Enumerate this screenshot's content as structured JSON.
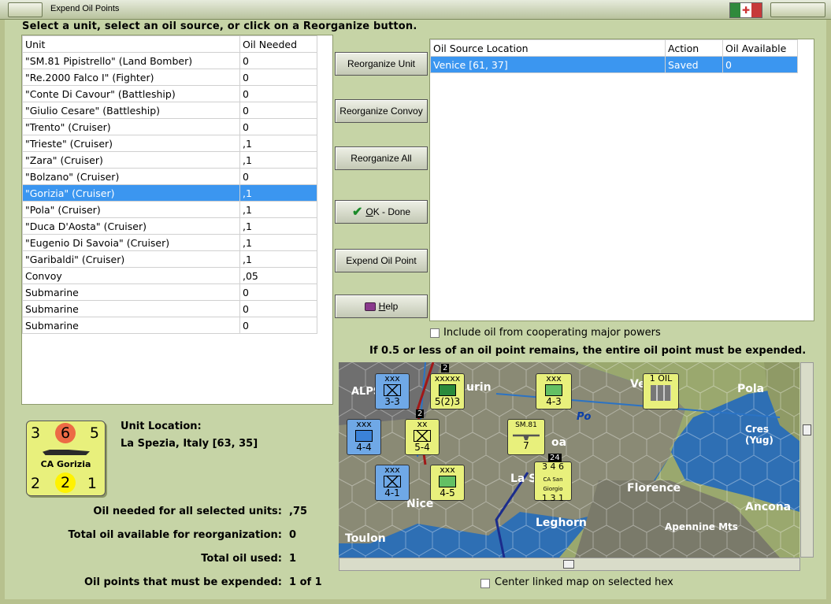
{
  "window": {
    "title": "Expend Oil Points"
  },
  "instruction": "Select a unit, select an oil source, or click on a Reorganize button.",
  "units_table": {
    "headers": [
      "Unit",
      "Oil Needed"
    ],
    "rows": [
      [
        "\"SM.81 Pipistrello\" (Land Bomber)",
        "0"
      ],
      [
        "\"Re.2000 Falco I\" (Fighter)",
        "0"
      ],
      [
        "\"Conte Di Cavour\" (Battleship)",
        "0"
      ],
      [
        "\"Giulio Cesare\" (Battleship)",
        "0"
      ],
      [
        "\"Trento\" (Cruiser)",
        "0"
      ],
      [
        "\"Trieste\" (Cruiser)",
        ",1"
      ],
      [
        "\"Zara\" (Cruiser)",
        ",1"
      ],
      [
        "\"Bolzano\" (Cruiser)",
        "0"
      ],
      [
        "\"Gorizia\" (Cruiser)",
        ",1"
      ],
      [
        "\"Pola\" (Cruiser)",
        ",1"
      ],
      [
        "\"Duca D'Aosta\" (Cruiser)",
        ",1"
      ],
      [
        "\"Eugenio Di Savoia\" (Cruiser)",
        ",1"
      ],
      [
        "\"Garibaldi\" (Cruiser)",
        ",1"
      ],
      [
        "Convoy",
        ",05"
      ],
      [
        "Submarine",
        "0"
      ],
      [
        "Submarine",
        "0"
      ],
      [
        "Submarine",
        "0"
      ]
    ],
    "selected_index": 8
  },
  "buttons": {
    "reorganize_unit": "Reorganize Unit",
    "reorganize_convoy": "Reorganize Convoy",
    "reorganize_all": "Reorganize All",
    "ok_done_first": "O",
    "ok_done_rest": "K - Done",
    "expend_oil_point": "Expend Oil Point",
    "help_first": "H",
    "help_rest": "elp"
  },
  "source_table": {
    "headers": [
      "Oil Source Location",
      "Action",
      "Oil Available"
    ],
    "rows": [
      [
        "Venice [61, 37]",
        "Saved",
        "0"
      ]
    ]
  },
  "include_oil_label": "Include oil from cooperating major powers",
  "oil_rule_note": "If 0.5 or less of an oil point remains, the entire oil point must be expended.",
  "unit_counter": {
    "top_left": "3",
    "top_mid": "6",
    "top_right": "5",
    "name": "CA Gorizia",
    "bottom_left": "2",
    "bottom_mid": "2",
    "bottom_right": "1"
  },
  "unit_location": {
    "label": "Unit Location:",
    "value": "La Spezia, Italy [63, 35]"
  },
  "summary": [
    {
      "label": "Oil needed for all selected units:",
      "value": ",75"
    },
    {
      "label": "Total oil available for reorganization:",
      "value": "0"
    },
    {
      "label": "Total oil used:",
      "value": "1"
    },
    {
      "label": "Oil points that must be expended:",
      "value": "1 of 1"
    }
  ],
  "center_map_label": "Center linked map on selected hex",
  "map": {
    "places": [
      "ALPS",
      "urin",
      "Ve",
      "Pola",
      "Po",
      "Cres (Yug)",
      "oa",
      "La S",
      "Florence",
      "Nice",
      "Leghorn",
      "Apennine Mts",
      "Ancona",
      "Toulon"
    ],
    "counters": [
      {
        "text": "3-3",
        "top": "xxx"
      },
      {
        "text": "5(2)3",
        "top": "xxxxx"
      },
      {
        "text": "4-3",
        "top": "xxx"
      },
      {
        "text": "1 OIL"
      },
      {
        "text": "4-4",
        "top": "xxx"
      },
      {
        "text": "5-4",
        "top": "xx"
      },
      {
        "text": "7",
        "top": "SM.81"
      },
      {
        "text": "4-1",
        "top": "xxx"
      },
      {
        "text": "4-5",
        "top": "xxx"
      },
      {
        "text": "3 4 6",
        "bottom": "1 3 1",
        "name": "CA San Giorgio"
      }
    ],
    "stack_badges": [
      "2",
      "2",
      "24"
    ]
  }
}
